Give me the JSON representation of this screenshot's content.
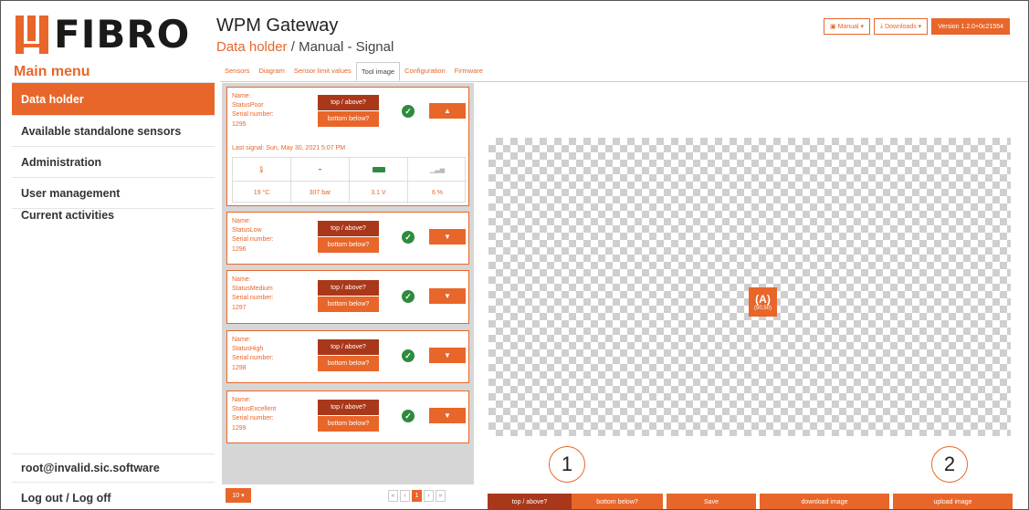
{
  "brand": {
    "logo_text": "FIBRO",
    "accent": "#e8662a",
    "dark_accent": "#a9381b",
    "success": "#2e8b3e"
  },
  "header": {
    "app_title": "WPM Gateway",
    "breadcrumb_active": "Data holder",
    "breadcrumb_sep": " / ",
    "breadcrumb_rest": "Manual - Signal",
    "manual_btn": "Manual",
    "downloads_btn": "Downloads",
    "version_btn": "Version 1.2.0+0c21554"
  },
  "sidebar": {
    "title": "Main menu",
    "items": [
      {
        "label": "Data holder"
      },
      {
        "label": "Available standalone sensors"
      },
      {
        "label": "Administration"
      },
      {
        "label": "User management"
      },
      {
        "label": "Current activities"
      }
    ],
    "user": "root@invalid.sic.software",
    "logout": "Log out / Log off"
  },
  "tabs": [
    "Sensors",
    "Diagram",
    "Sensor limit values",
    "Tool image",
    "Configuration",
    "Firmware"
  ],
  "card_labels": {
    "name": "Name:",
    "serial": "Serial number:",
    "top": "top / above?",
    "bottom": "bottom below?"
  },
  "cards": [
    {
      "name": "StatusPoor",
      "serial": "1295",
      "expanded": true,
      "last_signal": "Last signal: Sun, May 30, 2021 5:07 PM",
      "metrics": [
        "19 °C",
        "307 bar",
        "3.1 V",
        "6 %"
      ]
    },
    {
      "name": "StatusLow",
      "serial": "1296",
      "expanded": false
    },
    {
      "name": "StatusMedium",
      "serial": "1297",
      "expanded": false
    },
    {
      "name": "StatusHigh",
      "serial": "1298",
      "expanded": false
    },
    {
      "name": "StatusExcellent",
      "serial": "1299",
      "expanded": false
    }
  ],
  "pagination": {
    "page_size": "10",
    "current_page": "1"
  },
  "canvas": {
    "marker_icon": "(A)",
    "marker_coord": "(50,50)"
  },
  "actions": {
    "top": "top / above?",
    "bottom": "bottom below?",
    "save": "Save",
    "download": "download image",
    "upload": "upload image"
  },
  "callouts": [
    "1",
    "2"
  ]
}
